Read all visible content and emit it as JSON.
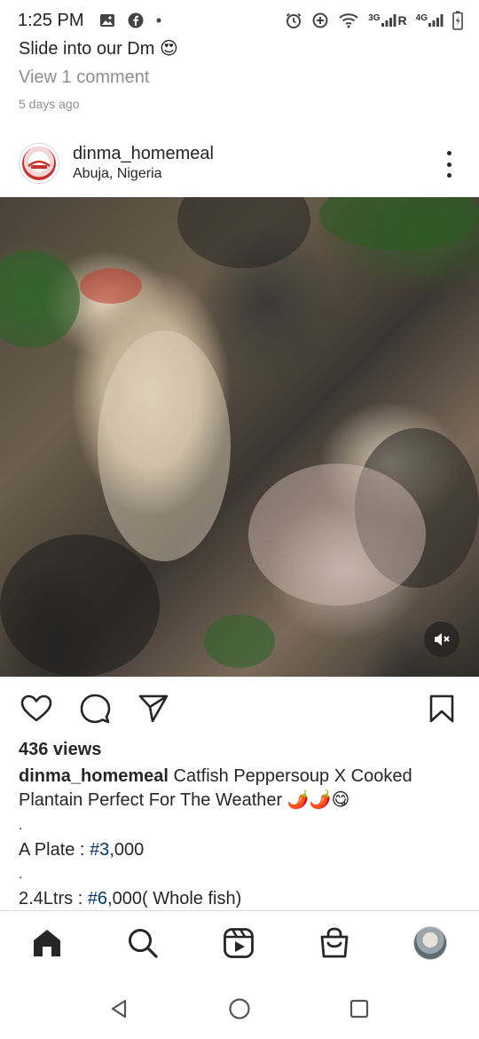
{
  "status_bar": {
    "time": "1:25 PM",
    "network_3g": "3G",
    "network_r": "R",
    "network_4g": "4G"
  },
  "previous_post": {
    "caption": "Slide into our Dm 😍",
    "view_comments": "View 1 comment",
    "time_ago": "5 days ago"
  },
  "post": {
    "username": "dinma_homemeal",
    "location": "Abuja, Nigeria",
    "views": "436 views",
    "caption_username": "dinma_homemeal",
    "caption_text": " Catfish Peppersoup X Cooked Plantain Perfect For The Weather 🌶️🌶️😋",
    "dot1": ".",
    "price1_label": "A Plate : ",
    "price1_hashtag": "#3",
    "price1_rest": ",000",
    "dot2": ".",
    "price2_label": "2.4Ltrs : ",
    "price2_hashtag": "#6",
    "price2_rest": ",000( Whole fish)"
  },
  "icons": {
    "like": "heart-icon",
    "comment": "comment-icon",
    "share": "send-icon",
    "save": "bookmark-icon",
    "mute": "muted-speaker-icon",
    "more": "more-vertical-icon"
  },
  "bottom_nav": [
    "home-icon",
    "search-icon",
    "reels-icon",
    "shop-icon",
    "profile-avatar"
  ],
  "colors": {
    "text": "#262626",
    "secondary_text": "#8e8e8e",
    "hashtag": "#00376b",
    "divider": "#dbdbdb"
  }
}
